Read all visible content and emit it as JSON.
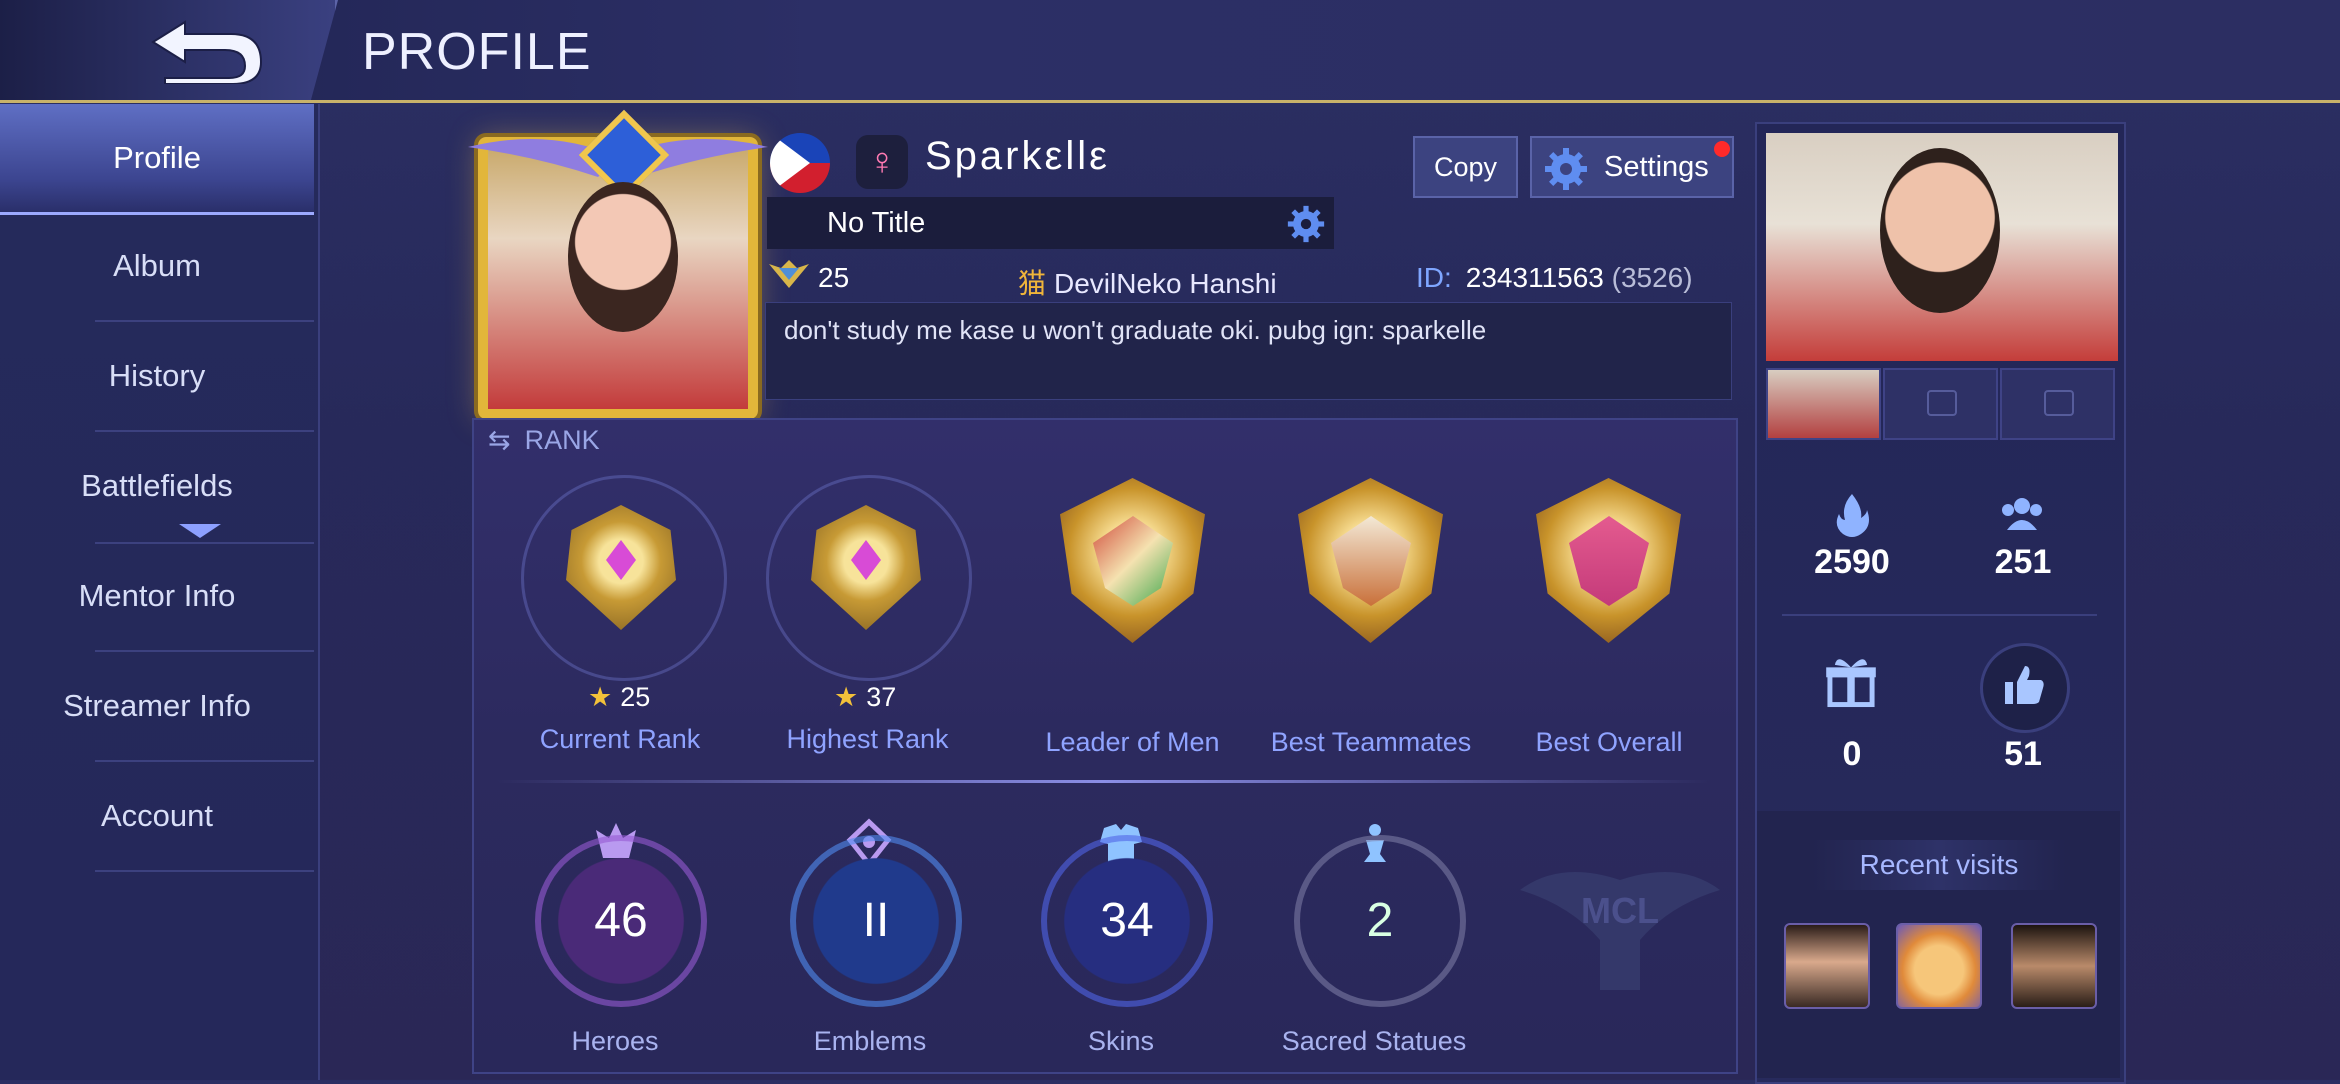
{
  "header": {
    "title": "PROFILE"
  },
  "sidebar": {
    "items": [
      {
        "label": "Profile",
        "active": true
      },
      {
        "label": "Album",
        "active": false
      },
      {
        "label": "History",
        "active": false
      },
      {
        "label": "Battlefields",
        "active": false
      },
      {
        "label": "Mentor Info",
        "active": false
      },
      {
        "label": "Streamer Info",
        "active": false
      },
      {
        "label": "Account",
        "active": false
      }
    ]
  },
  "player": {
    "name": "Sparkεllε",
    "title": "No Title",
    "level": "25",
    "squad_tag": "猫",
    "squad_name": "DevilNeko Hanshi",
    "id_label": "ID:",
    "id": "234311563",
    "zone": "(3526)",
    "bio": "don't study me kase u won't graduate oki. pubg ign: sparkelle"
  },
  "buttons": {
    "copy": "Copy",
    "settings": "Settings"
  },
  "rank": {
    "section_label": "RANK",
    "current": {
      "stars": "25",
      "caption": "Current Rank"
    },
    "highest": {
      "stars": "37",
      "caption": "Highest Rank"
    },
    "badges": [
      {
        "caption": "Leader of Men"
      },
      {
        "caption": "Best Teammates"
      },
      {
        "caption": "Best Overall"
      }
    ]
  },
  "collection": [
    {
      "value": "46",
      "caption": "Heroes",
      "icon": "heroes-icon"
    },
    {
      "value": "II",
      "caption": "Emblems",
      "icon": "emblems-icon"
    },
    {
      "value": "34",
      "caption": "Skins",
      "icon": "skins-icon"
    },
    {
      "value": "2",
      "caption": "Sacred Statues",
      "icon": "statue-icon"
    }
  ],
  "mcl_label": "MCL",
  "social": {
    "popularity": "2590",
    "followers": "251",
    "gifts": "0",
    "likes": "51"
  },
  "recent": {
    "title": "Recent visits"
  },
  "colors": {
    "accent": "#8fa3ff",
    "gold": "#e2b63a",
    "notification": "#ff2a2a"
  }
}
